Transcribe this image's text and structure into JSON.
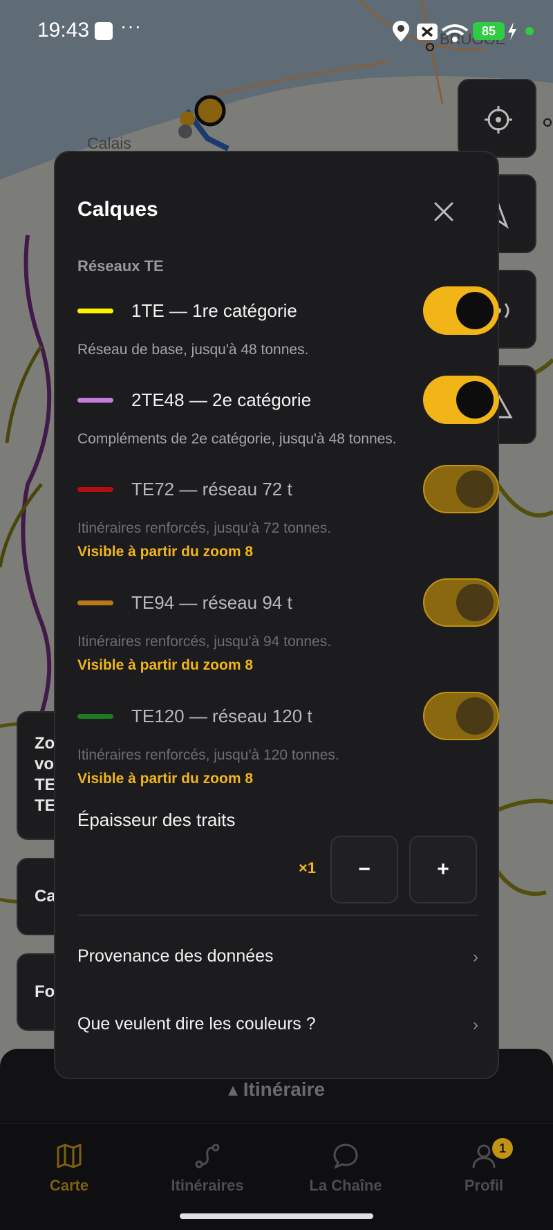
{
  "status_bar": {
    "time": "19:43",
    "dots": "···",
    "battery": "85"
  },
  "map": {
    "labels": {
      "calais": "Calais",
      "brugge": "BRUGGE"
    }
  },
  "side_cards": {
    "card1": [
      "Zo",
      "vo",
      "TE",
      "TE"
    ],
    "card2": "Ca",
    "card3": "Fo"
  },
  "panel": {
    "title": "Calques",
    "section_title": "Réseaux TE",
    "layers": [
      {
        "name": "1TE — 1re catégorie",
        "description": "Réseau de base, jusqu'à 48 tonnes.",
        "color": "#fff200",
        "enabled": true,
        "note": ""
      },
      {
        "name": "2TE48 — 2e catégorie",
        "description": "Compléments de 2e catégorie, jusqu'à 48 tonnes.",
        "color": "#c77ad8",
        "enabled": true,
        "note": ""
      },
      {
        "name": "TE72 — réseau 72 t",
        "description": "Itinéraires renforcés, jusqu'à 72 tonnes.",
        "color": "#b10f13",
        "enabled": false,
        "note": "Visible à partir du zoom 8"
      },
      {
        "name": "TE94 — réseau 94 t",
        "description": "Itinéraires renforcés, jusqu'à 94 tonnes.",
        "color": "#b9791a",
        "enabled": false,
        "note": "Visible à partir du zoom 8"
      },
      {
        "name": "TE120 — réseau 120 t",
        "description": "Itinéraires renforcés, jusqu'à 120 tonnes.",
        "color": "#1e7b24",
        "enabled": false,
        "note": "Visible à partir du zoom 8"
      }
    ],
    "thickness": {
      "title": "Épaisseur des traits",
      "value": "×1",
      "minus": "−",
      "plus": "+"
    },
    "links": [
      {
        "label": "Provenance des données",
        "chevron": "›"
      },
      {
        "label": "Que veulent dire les couleurs ?",
        "chevron": "›"
      }
    ]
  },
  "route_bar": {
    "label": "▴ Itinéraire"
  },
  "tabs": [
    {
      "label": "Carte",
      "icon": "map-icon",
      "active": true
    },
    {
      "label": "Itinéraires",
      "icon": "route-icon",
      "active": false
    },
    {
      "label": "La Chaîne",
      "icon": "chat-bubble-icon",
      "active": false
    },
    {
      "label": "Profil",
      "icon": "profile-icon",
      "active": false,
      "badge": "1"
    }
  ],
  "colors": {
    "accent": "#f2b518",
    "panel_bg": "#1c1c1e"
  }
}
